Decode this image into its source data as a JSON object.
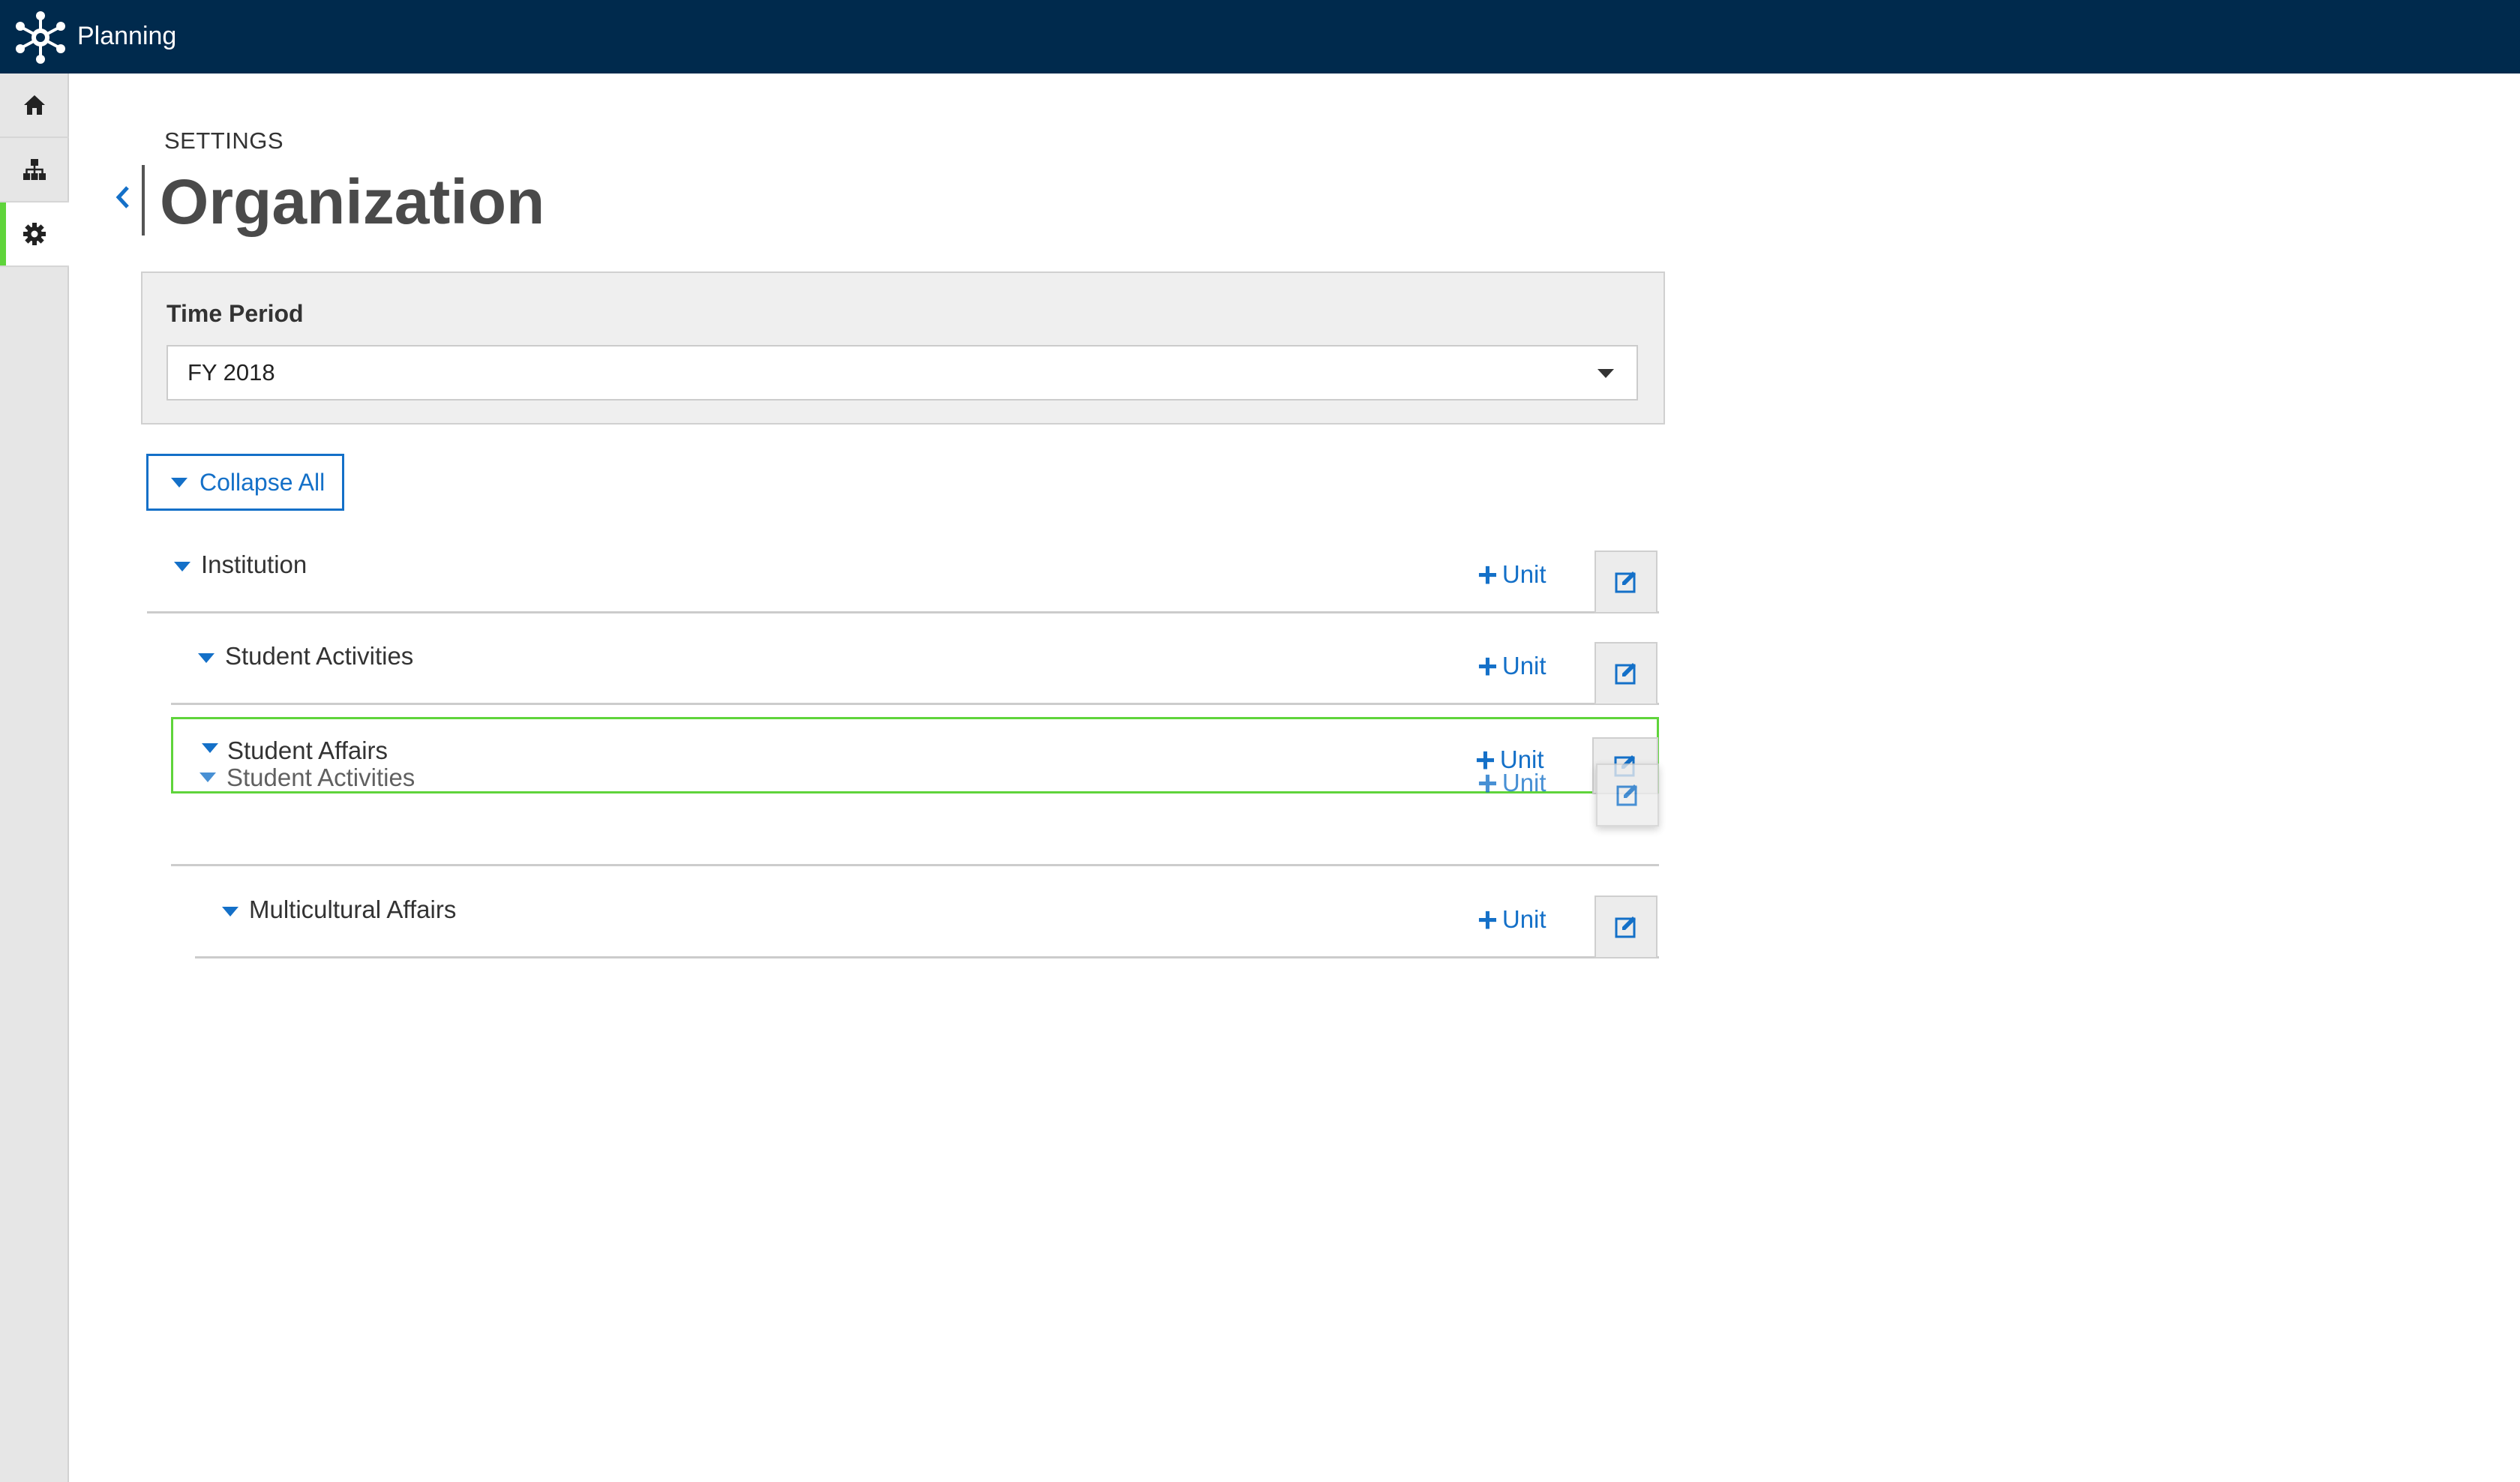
{
  "app": {
    "title": "Planning",
    "logo_icon": "network-hub-icon"
  },
  "sidebar": {
    "items": [
      {
        "name": "home",
        "icon": "home-icon",
        "active": false
      },
      {
        "name": "hierarchy",
        "icon": "org-chart-icon",
        "active": false
      },
      {
        "name": "settings",
        "icon": "gear-icon",
        "active": true
      }
    ],
    "active_color": "#5fd43b"
  },
  "header": {
    "section": "SETTINGS",
    "title": "Organization",
    "back_icon": "chevron-left-icon"
  },
  "time_period": {
    "label": "Time Period",
    "selected": "FY 2018"
  },
  "toolbar": {
    "collapse_all_label": "Collapse All"
  },
  "tree": {
    "add_unit_label": "Unit",
    "edit_icon": "edit-square-icon",
    "rows": [
      {
        "name": "Institution",
        "level": 0
      },
      {
        "name": "Student Activities",
        "level": 1
      },
      {
        "name": "Student Affairs",
        "level": 1,
        "drop_target": true
      },
      {
        "name": "Multicultural Affairs",
        "level": 2
      }
    ],
    "dragging": {
      "name": "Student Activities",
      "add_unit_label": "Unit"
    }
  },
  "colors": {
    "topbar": "#002a4d",
    "accent": "#1470c8",
    "drop_highlight": "#5fd43b"
  }
}
